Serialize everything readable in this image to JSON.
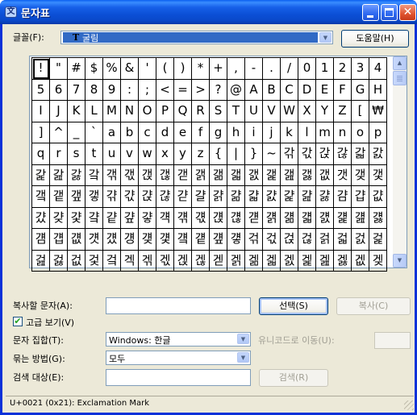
{
  "window": {
    "title": "문자표",
    "app_icon_glyph": "文"
  },
  "font": {
    "label": "글꼴(F):",
    "type_glyph": "T",
    "selected": "굴림",
    "help_button": "도움말(H)"
  },
  "grid": {
    "columns": 20,
    "selected_index": 0,
    "chars": [
      "!",
      "\"",
      "#",
      "$",
      "%",
      "&",
      "'",
      "(",
      ")",
      "*",
      "+",
      ",",
      "-",
      ".",
      "/",
      "0",
      "1",
      "2",
      "3",
      "4",
      "5",
      "6",
      "7",
      "8",
      "9",
      ":",
      ";",
      "<",
      "=",
      ">",
      "?",
      "@",
      "A",
      "B",
      "C",
      "D",
      "E",
      "F",
      "G",
      "H",
      "I",
      "J",
      "K",
      "L",
      "M",
      "N",
      "O",
      "P",
      "Q",
      "R",
      "S",
      "T",
      "U",
      "V",
      "W",
      "X",
      "Y",
      "Z",
      "[",
      "₩",
      "]",
      "^",
      "_",
      "`",
      "a",
      "b",
      "c",
      "d",
      "e",
      "f",
      "g",
      "h",
      "i",
      "j",
      "k",
      "l",
      "m",
      "n",
      "o",
      "p",
      "q",
      "r",
      "s",
      "t",
      "u",
      "v",
      "w",
      "x",
      "y",
      "z",
      "{",
      "|",
      "}",
      "~",
      "갂",
      "갃",
      "갅",
      "갆",
      "갋",
      "갌",
      "갍",
      "갎",
      "갏",
      "갘",
      "갞",
      "갟",
      "갡",
      "갢",
      "갣",
      "갥",
      "갦",
      "갧",
      "갨",
      "갩",
      "갪",
      "갫",
      "갮",
      "갯",
      "갲",
      "갳",
      "갴",
      "갵",
      "갶",
      "갷",
      "갺",
      "갻",
      "갽",
      "갾",
      "갿",
      "걀",
      "걁",
      "걂",
      "걃",
      "걄",
      "걅",
      "걆",
      "걇",
      "걈",
      "걉",
      "걊",
      "걌",
      "걎",
      "걏",
      "걐",
      "걑",
      "걒",
      "걓",
      "걕",
      "걖",
      "걗",
      "걙",
      "걚",
      "걛",
      "걝",
      "걞",
      "걟",
      "걠",
      "걡",
      "걢",
      "걣",
      "걤",
      "걥",
      "걦",
      "걧",
      "걨",
      "걩",
      "걪",
      "걫",
      "걬",
      "걭",
      "걮",
      "걯",
      "걲",
      "걳",
      "걵",
      "걶",
      "걹",
      "걻",
      "걼",
      "걽",
      "걾",
      "걿",
      "겂",
      "겇",
      "겈",
      "겍",
      "겎",
      "겏",
      "겑",
      "겒",
      "겓",
      "겕",
      "겖",
      "겗",
      "겘",
      "겙",
      "겚",
      "겛",
      "겞",
      "겢"
    ]
  },
  "scrollbar": {
    "up_glyph": "▲",
    "down_glyph": "▼",
    "position_fraction": 0.0
  },
  "copy": {
    "label": "복사할 문자(A):",
    "value": "",
    "select_button": "선택(S)",
    "copy_button": "복사(C)"
  },
  "advanced": {
    "label": "고급 보기(V)",
    "checked": true,
    "check_glyph": "✔"
  },
  "charset": {
    "label": "문자 집합(T):",
    "value": "Windows: 한글",
    "unicode_label": "유니코드로 이동(U):",
    "unicode_value": ""
  },
  "grouping": {
    "label": "묶는 방법(G):",
    "value": "모두"
  },
  "search": {
    "label": "검색 대상(E):",
    "value": "",
    "button": "검색(R)"
  },
  "status": {
    "text": "U+0021 (0x21): Exclamation Mark"
  },
  "colors": {
    "title_bar": "#0a4fd6",
    "window_face": "#ece9d8",
    "selection": "#316ac5",
    "check_green": "#21a121"
  }
}
